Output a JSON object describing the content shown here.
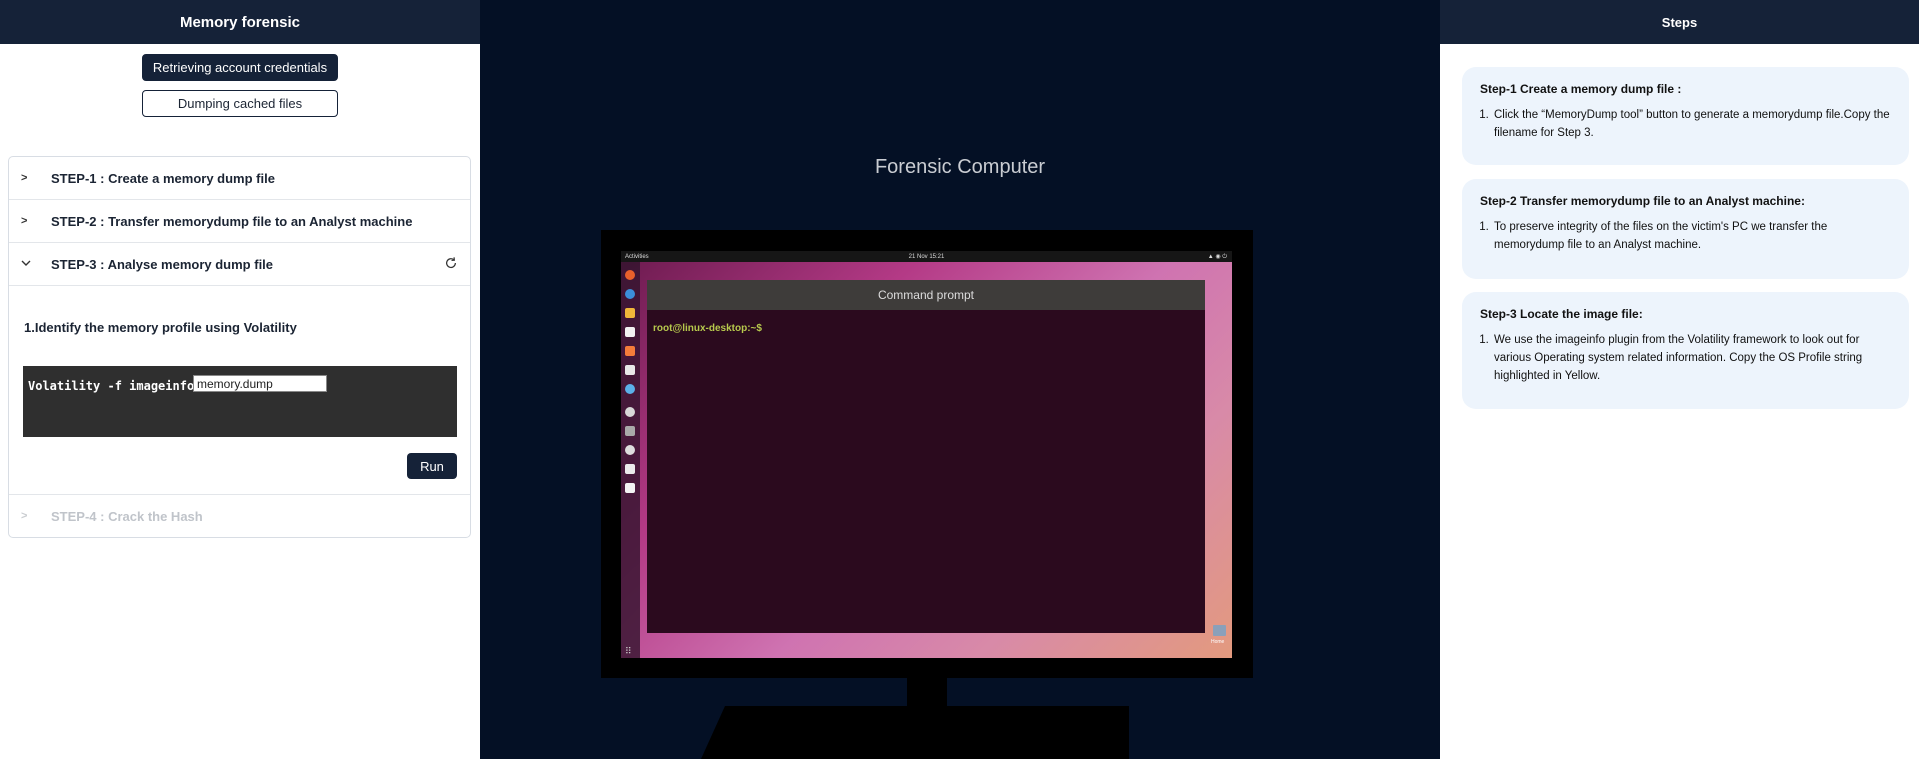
{
  "left_panel": {
    "title": "Memory forensic",
    "modes": [
      "Retrieving account credentials",
      "Dumping cached files"
    ],
    "steps": [
      {
        "label": "STEP-1 : Create a memory dump file",
        "state": "collapsed"
      },
      {
        "label": "STEP-2 : Transfer memorydump file to an Analyst machine",
        "state": "collapsed"
      },
      {
        "label": "STEP-3 : Analyse memory dump file",
        "state": "expanded"
      },
      {
        "label": "STEP-4 : Crack the Hash",
        "state": "disabled"
      }
    ],
    "step3": {
      "instruction": "1.Identify the memory profile using Volatility",
      "command": "Volatility -f imageinfo",
      "input_value": "memory.dump",
      "run_label": "Run"
    }
  },
  "middle": {
    "title": "Forensic Computer",
    "desktop": {
      "activities": "Activities",
      "clock": "21 Nov 15:21",
      "terminal_title": "Command prompt",
      "prompt": "root@linux-desktop:~$",
      "home_label": "Home"
    }
  },
  "right_panel": {
    "title": "Steps",
    "cards": [
      {
        "title": "Step-1 Create a memory dump file :",
        "items": [
          "Click the “MemoryDump tool” button to generate a memorydump file.Copy the filename for Step 3."
        ]
      },
      {
        "title": "Step-2 Transfer memorydump file to an Analyst machine:",
        "items": [
          "To preserve integrity of the files on the victim's PC we transfer the memorydump file to an Analyst machine."
        ]
      },
      {
        "title": "Step-3 Locate the image file:",
        "items": [
          "We use the imageinfo plugin from the Volatility framework to look out for various Operating system related information. Copy the OS Profile string highlighted in Yellow."
        ]
      }
    ]
  },
  "colors": {
    "navy": "#152238",
    "middle_bg": "#041025",
    "card_bg": "#edf4fc",
    "prompt_green": "#b7c94d"
  }
}
